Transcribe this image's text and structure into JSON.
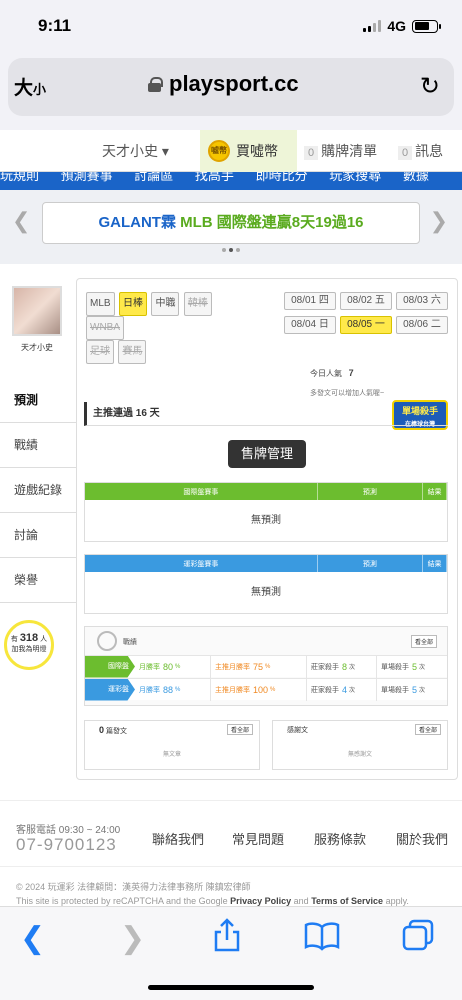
{
  "status_bar": {
    "time": "9:11",
    "network": "4G"
  },
  "browser": {
    "text_size": "大",
    "text_size_small": "小",
    "url": "playsport.cc",
    "reload_icon": "reload-icon"
  },
  "site_nav": {
    "user_name": "天才小史 ▾",
    "buy_coins": "買噓幣",
    "coin_icon_text": "噓幣",
    "cart_count": "0",
    "cart_label": "購牌清單",
    "msg_count": "0",
    "msg_label": "訊息",
    "blue_items": [
      "玩規則",
      "預測賽事",
      "討論區",
      "找高手",
      "即時比分",
      "玩家搜尋",
      "數據"
    ]
  },
  "banner": {
    "prefix": "GALANT霖",
    "text": " MLB 國際盤連贏8天19過16"
  },
  "profile": {
    "avatar_name": "天才小史"
  },
  "side_menu": [
    {
      "label": "預測"
    },
    {
      "label": "戰績"
    },
    {
      "label": "遊戲紀錄"
    },
    {
      "label": "討論"
    },
    {
      "label": "榮譽"
    }
  ],
  "fans": {
    "prefix": "有",
    "count": "318",
    "suffix": "人",
    "line2": "加我為明燈"
  },
  "league_tags": [
    "MLB",
    "日棒",
    "中職",
    "韓棒",
    "WNBA",
    "足球",
    "賽馬"
  ],
  "dates": [
    "08/01 四",
    "08/02 五",
    "08/03 六",
    "08/04 日",
    "08/05 一",
    "08/06 二"
  ],
  "popular": {
    "label": "今日人氣",
    "value": "7"
  },
  "add_note": "多發文可以增加人氣喔~",
  "badge": {
    "line1": "單場殺手",
    "line2": "在棒球台灣"
  },
  "streak": "主推連過 16 天",
  "tooltip": "售牌管理",
  "table_intl": {
    "h1": "國際盤賽事",
    "h2": "預測",
    "h3": "結果",
    "empty": "無預測"
  },
  "table_sport": {
    "h1": "運彩盤賽事",
    "h2": "預測",
    "h3": "結果",
    "empty": "無預測"
  },
  "record": {
    "title": "戰績",
    "all": "看全部",
    "rows": [
      {
        "label": "國際盤",
        "c1l": "月勝率",
        "c1v": "80",
        "c2l": "主推月勝率",
        "c2v": "75",
        "c3l": "莊家殺手",
        "c3v": "8",
        "c4l": "單場殺手",
        "c4v": "5"
      },
      {
        "label": "運彩盤",
        "c1l": "月勝率",
        "c1v": "88",
        "c2l": "主推月勝率",
        "c2v": "100",
        "c3l": "莊家殺手",
        "c3v": "4",
        "c4l": "單場殺手",
        "c4v": "5"
      }
    ],
    "pct": "%",
    "times": "次"
  },
  "posts": {
    "count": "0",
    "label": "篇發文",
    "all": "看全部",
    "empty": "無文章"
  },
  "feedback": {
    "label": "感謝文",
    "all": "看全部",
    "empty": "無感謝文"
  },
  "footer": {
    "svc": "客服電話 09:30 ~ 24:00",
    "phone": "07-9700123",
    "links": [
      "聯絡我們",
      "常見問題",
      "服務條款",
      "關於我們"
    ],
    "copyright": "© 2024 玩運彩 法律顧問：漢英得力法律事務所 陳鎮宏律師",
    "recaptcha1": "This site is protected by reCAPTCHA and the Google ",
    "privacy": "Privacy Policy",
    "and": " and ",
    "terms": "Terms of Service",
    "apply": " apply."
  },
  "colors": {
    "green": "#6cbd2f",
    "blue": "#3a9ae0",
    "yellow": "#ffe94a"
  }
}
